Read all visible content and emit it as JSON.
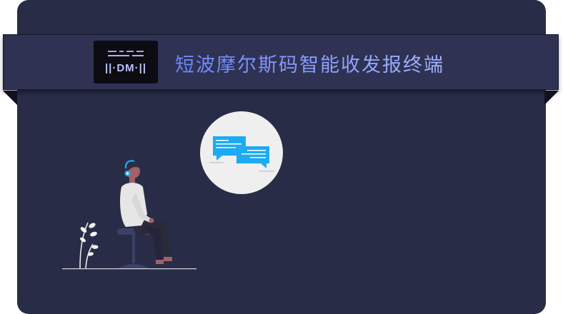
{
  "banner": {
    "logo_text": "||·DM·||",
    "title": "短波摩尔斯码智能收发报终端"
  },
  "colors": {
    "card_bg": "#282c47",
    "banner_bg": "#2f3253",
    "title_accent": "#7f95ff",
    "chat_bubble": "#1eaaf1"
  },
  "icons": {
    "logo": "morse-signal-logo-icon",
    "illustration": "headset-listener-illustration",
    "chat": "chat-bubbles-icon"
  }
}
